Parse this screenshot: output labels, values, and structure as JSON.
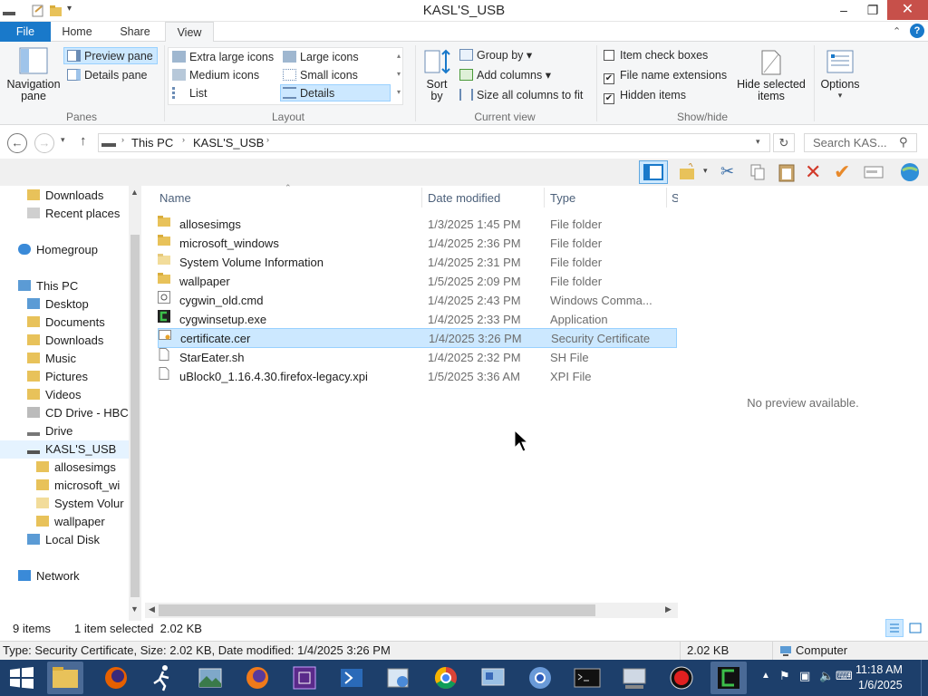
{
  "window": {
    "title": "KASL'S_USB"
  },
  "ribbon": {
    "tabs": [
      "File",
      "Home",
      "Share",
      "View"
    ],
    "panes": {
      "navigation_pane": "Navigation pane",
      "preview_pane": "Preview pane",
      "details_pane": "Details pane",
      "group_label": "Panes"
    },
    "layout": {
      "extra_large_icons": "Extra large icons",
      "large_icons": "Large icons",
      "medium_icons": "Medium icons",
      "small_icons": "Small icons",
      "list": "List",
      "details": "Details",
      "group_label": "Layout"
    },
    "current_view": {
      "sort_by": "Sort by",
      "group_by": "Group by",
      "add_columns": "Add columns",
      "size_all_columns": "Size all columns to fit",
      "group_label": "Current view"
    },
    "show_hide": {
      "item_check_boxes": "Item check boxes",
      "item_check_boxes_checked": false,
      "file_name_extensions": "File name extensions",
      "file_name_extensions_checked": true,
      "hidden_items": "Hidden items",
      "hidden_items_checked": true,
      "hide_selected_items": "Hide selected items",
      "group_label": "Show/hide"
    },
    "options": "Options"
  },
  "address": {
    "crumbs": [
      "This PC",
      "KASL'S_USB"
    ],
    "search_placeholder": "Search KAS..."
  },
  "nav": {
    "items": [
      {
        "label": "Downloads",
        "icon": "downloads-folder-icon"
      },
      {
        "label": "Recent places",
        "icon": "recent-places-icon"
      },
      {
        "label": "Homegroup",
        "icon": "homegroup-icon"
      },
      {
        "label": "This PC",
        "icon": "computer-icon"
      },
      {
        "label": "Desktop",
        "icon": "folder-icon"
      },
      {
        "label": "Documents",
        "icon": "folder-icon"
      },
      {
        "label": "Downloads",
        "icon": "folder-icon"
      },
      {
        "label": "Music",
        "icon": "folder-icon"
      },
      {
        "label": "Pictures",
        "icon": "folder-icon"
      },
      {
        "label": "Videos",
        "icon": "folder-icon"
      },
      {
        "label": "CD Drive - HBC",
        "icon": "cd-drive-icon"
      },
      {
        "label": "Drive",
        "icon": "drive-icon"
      },
      {
        "label": "KASL'S_USB",
        "icon": "usb-drive-icon"
      },
      {
        "label": "allosesimgs",
        "icon": "folder-icon"
      },
      {
        "label": "microsoft_wi",
        "icon": "folder-icon"
      },
      {
        "label": "System Volur",
        "icon": "folder-icon"
      },
      {
        "label": "wallpaper",
        "icon": "folder-icon"
      },
      {
        "label": "Local Disk",
        "icon": "local-disk-icon"
      },
      {
        "label": "Network",
        "icon": "network-icon"
      }
    ]
  },
  "columns": {
    "name": "Name",
    "date_modified": "Date modified",
    "type": "Type",
    "size": "S"
  },
  "files": [
    {
      "name": "allosesimgs",
      "date": "1/3/2025 1:45 PM",
      "type": "File folder"
    },
    {
      "name": "microsoft_windows",
      "date": "1/4/2025 2:36 PM",
      "type": "File folder"
    },
    {
      "name": "System Volume Information",
      "date": "1/4/2025 2:31 PM",
      "type": "File folder"
    },
    {
      "name": "wallpaper",
      "date": "1/5/2025 2:09 PM",
      "type": "File folder"
    },
    {
      "name": "cygwin_old.cmd",
      "date": "1/4/2025 2:43 PM",
      "type": "Windows Comma..."
    },
    {
      "name": "cygwinsetup.exe",
      "date": "1/4/2025 2:33 PM",
      "type": "Application"
    },
    {
      "name": "certificate.cer",
      "date": "1/4/2025 3:26 PM",
      "type": "Security Certificate"
    },
    {
      "name": "StarEater.sh",
      "date": "1/4/2025 2:32 PM",
      "type": "SH File"
    },
    {
      "name": "uBlock0_1.16.4.30.firefox-legacy.xpi",
      "date": "1/5/2025 3:36 AM",
      "type": "XPI File"
    }
  ],
  "preview": {
    "message": "No preview available."
  },
  "status": {
    "item_count": "9 items",
    "selection": "1 item selected  2.02 KB",
    "details": "Type: Security Certificate, Size: 2.02 KB, Date modified: 1/4/2025 3:26 PM",
    "size": "2.02 KB",
    "location": "Computer"
  },
  "taskbar": {
    "time": "11:18 AM",
    "date": "1/6/2025"
  },
  "colors": {
    "file_tab": "#1979ca",
    "selection": "#cce8ff",
    "taskbar": "#1d3f6b",
    "close": "#c7504a"
  }
}
